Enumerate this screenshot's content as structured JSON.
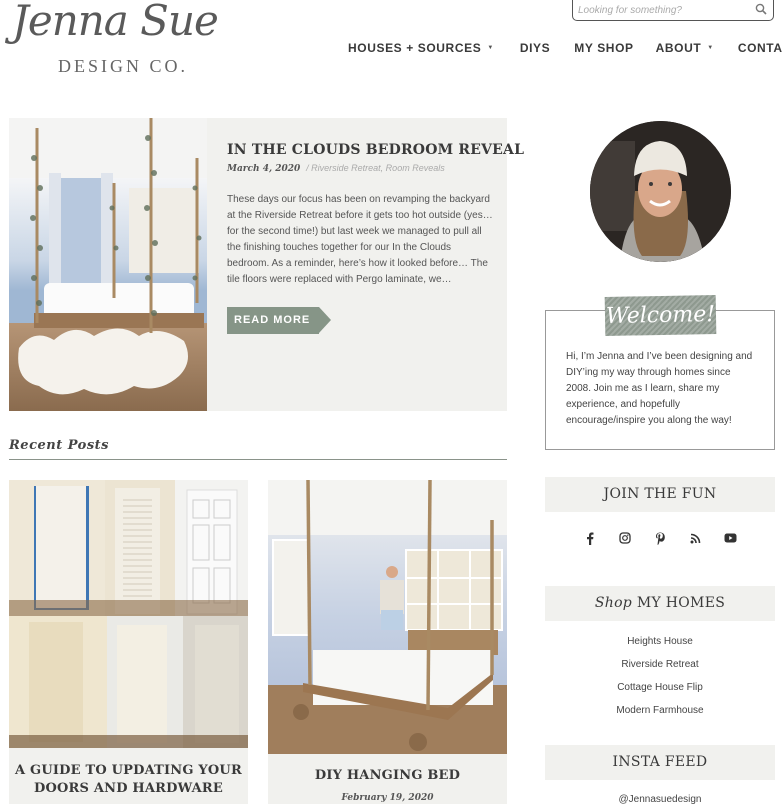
{
  "brand": {
    "logo_script": "Jenna Sue",
    "logo_sub": "DESIGN CO."
  },
  "search": {
    "placeholder": "Looking for something?",
    "icon": "search-icon"
  },
  "nav": {
    "items": [
      {
        "label": "HOUSES + SOURCES",
        "has_dropdown": true
      },
      {
        "label": "DIYS",
        "has_dropdown": false
      },
      {
        "label": "MY SHOP",
        "has_dropdown": false
      },
      {
        "label": "ABOUT",
        "has_dropdown": true
      },
      {
        "label": "CONTACT",
        "has_dropdown": false
      }
    ],
    "caret": "▼"
  },
  "featured": {
    "title": "IN THE CLOUDS BEDROOM REVEAL",
    "date": "March 4, 2020",
    "categories": "/ Riverside Retreat, Room Reveals",
    "excerpt": "These days our focus has been on revamping the backyard at the Riverside Retreat before it gets too hot outside (yes… for the second time!) but last week we managed to pull all the finishing touches together for our In the Clouds bedroom. As a reminder, here’s how it looked before… The tile floors were replaced with Pergo laminate, we…",
    "read_more": "READ MORE",
    "image_alt": "Hanging bed with vines in a cloud-painted bedroom"
  },
  "recent": {
    "heading": "Recent Posts",
    "posts": [
      {
        "title": "A GUIDE TO UPDATING YOUR DOORS AND HARDWARE",
        "date": "",
        "image_alt": "Collage of six updated interior doors"
      },
      {
        "title": "DIY HANGING BED",
        "date": "February 19, 2020",
        "image_alt": "Man hanging from a rope bed frame in a bedroom"
      }
    ]
  },
  "sidebar": {
    "welcome": {
      "badge": "Welcome!",
      "text": "Hi, I’m Jenna and I’ve been designing and DIY’ing my way through homes since 2008. Join me as I learn, share my experience, and hopefully encourage/inspire you along the way!"
    },
    "join": {
      "heading": "JOIN THE FUN",
      "social": [
        "facebook-icon",
        "instagram-icon",
        "pinterest-icon",
        "rss-icon",
        "youtube-icon"
      ]
    },
    "homes": {
      "heading_italic": "Shop",
      "heading_rest": "MY HOMES",
      "items": [
        "Heights House",
        "Riverside Retreat",
        "Cottage House Flip",
        "Modern Farmhouse"
      ]
    },
    "insta": {
      "heading": "INSTA FEED",
      "handle": "@Jennasuedesign"
    }
  },
  "colors": {
    "accent_green": "#869587",
    "panel_bg": "#f1f1ee",
    "text_dark": "#3a3a3a"
  }
}
